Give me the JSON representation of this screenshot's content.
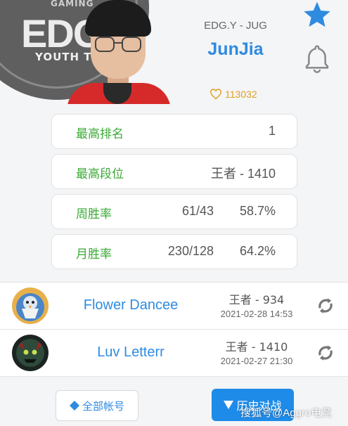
{
  "header": {
    "team_logo": {
      "top_text": "GAMING",
      "main_text": "EDG",
      "bottom_text": "YOUTH TE"
    },
    "team_role": "EDG.Y - JUG",
    "player_name": "JunJia",
    "likes": "113032",
    "icons": {
      "favorite": "star-icon",
      "notify": "bell-icon",
      "like": "heart-icon"
    },
    "colors": {
      "accent": "#2f8be0",
      "like": "#e0a020",
      "favorite": "#2f8be0"
    }
  },
  "stats": [
    {
      "label": "最高排名",
      "value": "1",
      "value2": ""
    },
    {
      "label": "最高段位",
      "value": "王者 - 1410",
      "value2": ""
    },
    {
      "label": "周胜率",
      "value": "61/43",
      "value2": "58.7%"
    },
    {
      "label": "月胜率",
      "value": "230/128",
      "value2": "64.2%"
    }
  ],
  "stats_label_color": "#3aaa35",
  "accounts": [
    {
      "name": "Flower Dancee",
      "rank": "王者 - 934",
      "time": "2021-02-28 14:53",
      "avatar": "champion-avatar-blue",
      "refresh": "refresh-icon"
    },
    {
      "name": "Luv Letterr",
      "rank": "王者 - 1410",
      "time": "2021-02-27 21:30",
      "avatar": "champion-avatar-dark",
      "refresh": "refresh-icon"
    }
  ],
  "buttons": {
    "all_accounts": "全部帐号",
    "history": "历史对战"
  },
  "watermark": "搜狐号@Aggro电竞"
}
